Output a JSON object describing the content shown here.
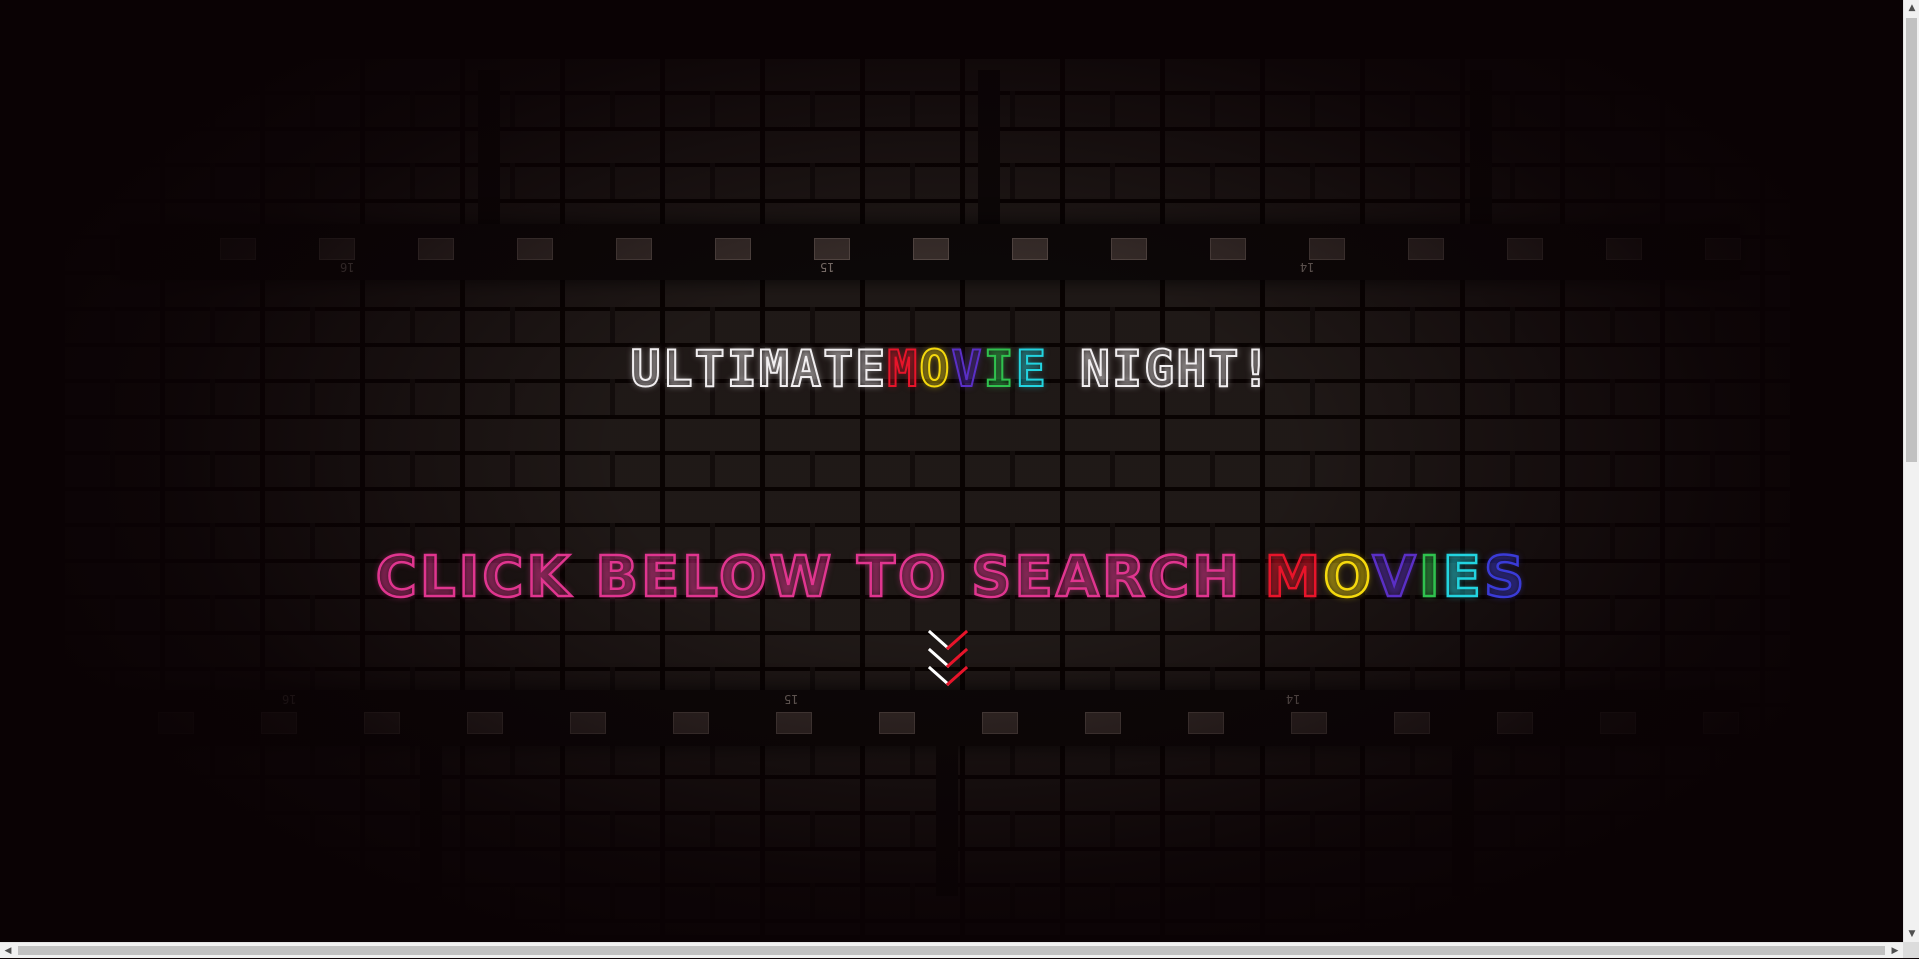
{
  "hero": {
    "title_parts": [
      {
        "text": "ULTIMATE",
        "color": "#f1eef0"
      },
      {
        "text": "M",
        "color": "#e8142a"
      },
      {
        "text": "O",
        "color": "#f5d90d"
      },
      {
        "text": "V",
        "color": "#5a2fc6"
      },
      {
        "text": "I",
        "color": "#2fc24e"
      },
      {
        "text": "E",
        "color": "#22d4e0"
      },
      {
        "text": " NIGHT!",
        "color": "#f1eef0"
      }
    ],
    "subtitle_parts": [
      {
        "text": "CLICK BELOW TO SEARCH ",
        "color": "#e0358f"
      },
      {
        "text": "M",
        "color": "#e8142a"
      },
      {
        "text": "O",
        "color": "#f5d90d"
      },
      {
        "text": "V",
        "color": "#5a2fc6"
      },
      {
        "text": "I",
        "color": "#2fc24e"
      },
      {
        "text": "E",
        "color": "#22d4e0"
      },
      {
        "text": "S",
        "color": "#3a3bd8"
      }
    ],
    "scroll_icon": "triple-chevron-down-icon"
  },
  "film_strips": {
    "frame_numbers_top": [
      "16",
      "15",
      "14"
    ],
    "frame_numbers_bottom": [
      "16",
      "15",
      "14"
    ]
  },
  "colors": {
    "background": "#0a0204",
    "brick": "#2a2321",
    "neon_pink": "#e0358f"
  }
}
